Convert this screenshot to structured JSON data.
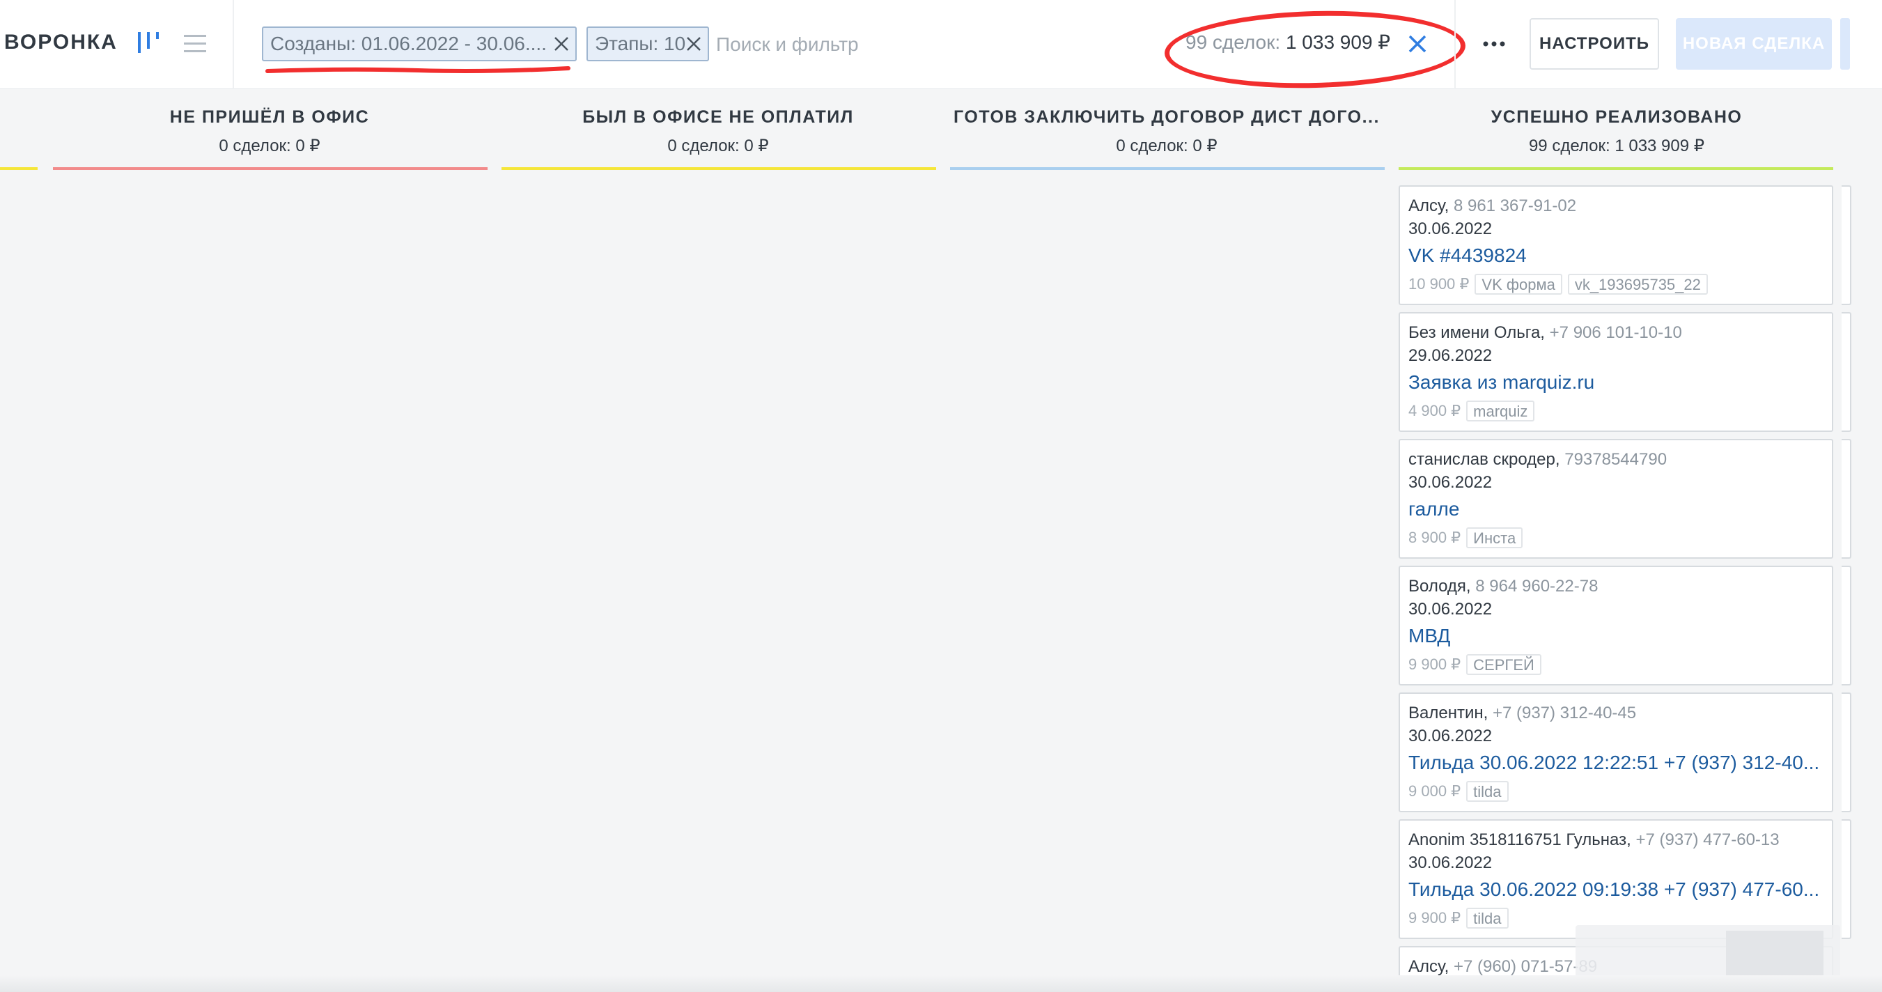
{
  "header": {
    "title": "ВОРОНКА",
    "filter_chips": [
      {
        "label": "Созданы: 01.06.2022 - 30.06...."
      },
      {
        "label": "Этапы: 10"
      }
    ],
    "search_placeholder": "Поиск и фильтр",
    "summary": {
      "count": "99 сделок:",
      "amount": "1 033 909 ₽"
    },
    "setup_label": "НАСТРОИТЬ",
    "new_deal_label": "НОВАЯ СДЕЛКА"
  },
  "columns": [
    {
      "title": "НЕ ПРИШЁЛ В ОФИС",
      "subtitle": "0 сделок: 0 ₽",
      "color": "#f28b8b"
    },
    {
      "title": "БЫЛ В ОФИСЕ НЕ ОПЛАТИЛ",
      "subtitle": "0 сделок: 0 ₽",
      "color": "#f5e63a"
    },
    {
      "title": "ГОТОВ ЗАКЛЮЧИТЬ ДОГОВОР ДИСТ ДОГО...",
      "subtitle": "0 сделок: 0 ₽",
      "color": "#a9cfef"
    },
    {
      "title": "УСПЕШНО РЕАЛИЗОВАНО",
      "subtitle": "99 сделок: 1 033 909 ₽",
      "color": "#c4ea5c"
    }
  ],
  "cards": [
    {
      "name": "Алсу,",
      "phone": "8 961 367-91-02",
      "date": "30.06.2022",
      "title": "VK #4439824",
      "price": "10 900 ₽",
      "tags": [
        "VK форма",
        "vk_193695735_22"
      ]
    },
    {
      "name": "Без имени Ольга,",
      "phone": "+7 906 101-10-10",
      "date": "29.06.2022",
      "title": "Заявка из marquiz.ru",
      "price": "4 900 ₽",
      "tags": [
        "marquiz"
      ]
    },
    {
      "name": "станислав скродер,",
      "phone": "79378544790",
      "date": "30.06.2022",
      "title": "галле",
      "price": "8 900 ₽",
      "tags": [
        "Инста"
      ]
    },
    {
      "name": "Володя,",
      "phone": "8 964 960-22-78",
      "date": "30.06.2022",
      "title": "МВД",
      "price": "9 900 ₽",
      "tags": [
        "СЕРГЕЙ"
      ]
    },
    {
      "name": "Валентин,",
      "phone": "+7 (937) 312-40-45",
      "date": "30.06.2022",
      "title": "Тильда 30.06.2022 12:22:51 +7 (937) 312-40...",
      "price": "9 000 ₽",
      "tags": [
        "tilda"
      ]
    },
    {
      "name": "Anonim 3518116751 Гульназ,",
      "phone": "+7 (937) 477-60-13",
      "date": "30.06.2022",
      "title": "Тильда 30.06.2022 09:19:38 +7 (937) 477-60...",
      "price": "9 900 ₽",
      "tags": [
        "tilda"
      ]
    },
    {
      "name": "Алсу,",
      "phone": "+7 (960) 071-57-89",
      "date": "",
      "title": "",
      "price": "",
      "tags": []
    }
  ],
  "colors": {
    "accent_blue": "#2f7de1",
    "link_blue": "#1c5b9e",
    "annotation_red": "#f22e2e"
  },
  "icons": [
    "pipeline-view-icon",
    "list-view-icon",
    "close-icon",
    "more-icon"
  ]
}
